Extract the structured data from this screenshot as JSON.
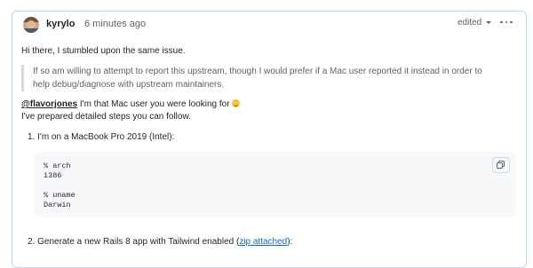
{
  "comment": {
    "author": "kyrylo",
    "timestamp": "6 minutes ago",
    "edited_label": "edited",
    "paragraph_intro": "Hi there, I stumbled upon the same issue.",
    "quote": "If so am willing to attempt to report this upstream, though I would prefer if a Mac user reported it instead in order to help debug/diagnose with upstream maintainers.",
    "mention": "@flavorjones",
    "mention_text": " I'm that Mac user you were looking for ",
    "line_prepared": "I've prepared detailed steps you can follow.",
    "list": [
      {
        "number": "1.",
        "text": "I'm on a MacBook Pro 2019 (Intel):"
      },
      {
        "number": "2.",
        "text_before": "Generate a new Rails 8 app with Tailwind enabled (",
        "link": "zip attached",
        "text_after": "):"
      }
    ],
    "code_block": "% arch\ni386\n\n% uname\nDarwin"
  },
  "icons": {
    "avatar": "user-avatar",
    "more": "kebab-menu-icon",
    "caret": "chevron-down-icon",
    "copy": "copy-icon",
    "emoji": "smile-emoji-icon"
  },
  "colors": {
    "border": "#b6d7f5",
    "link": "#0969da",
    "muted": "#59636e",
    "code_bg": "#f6f8fa"
  }
}
